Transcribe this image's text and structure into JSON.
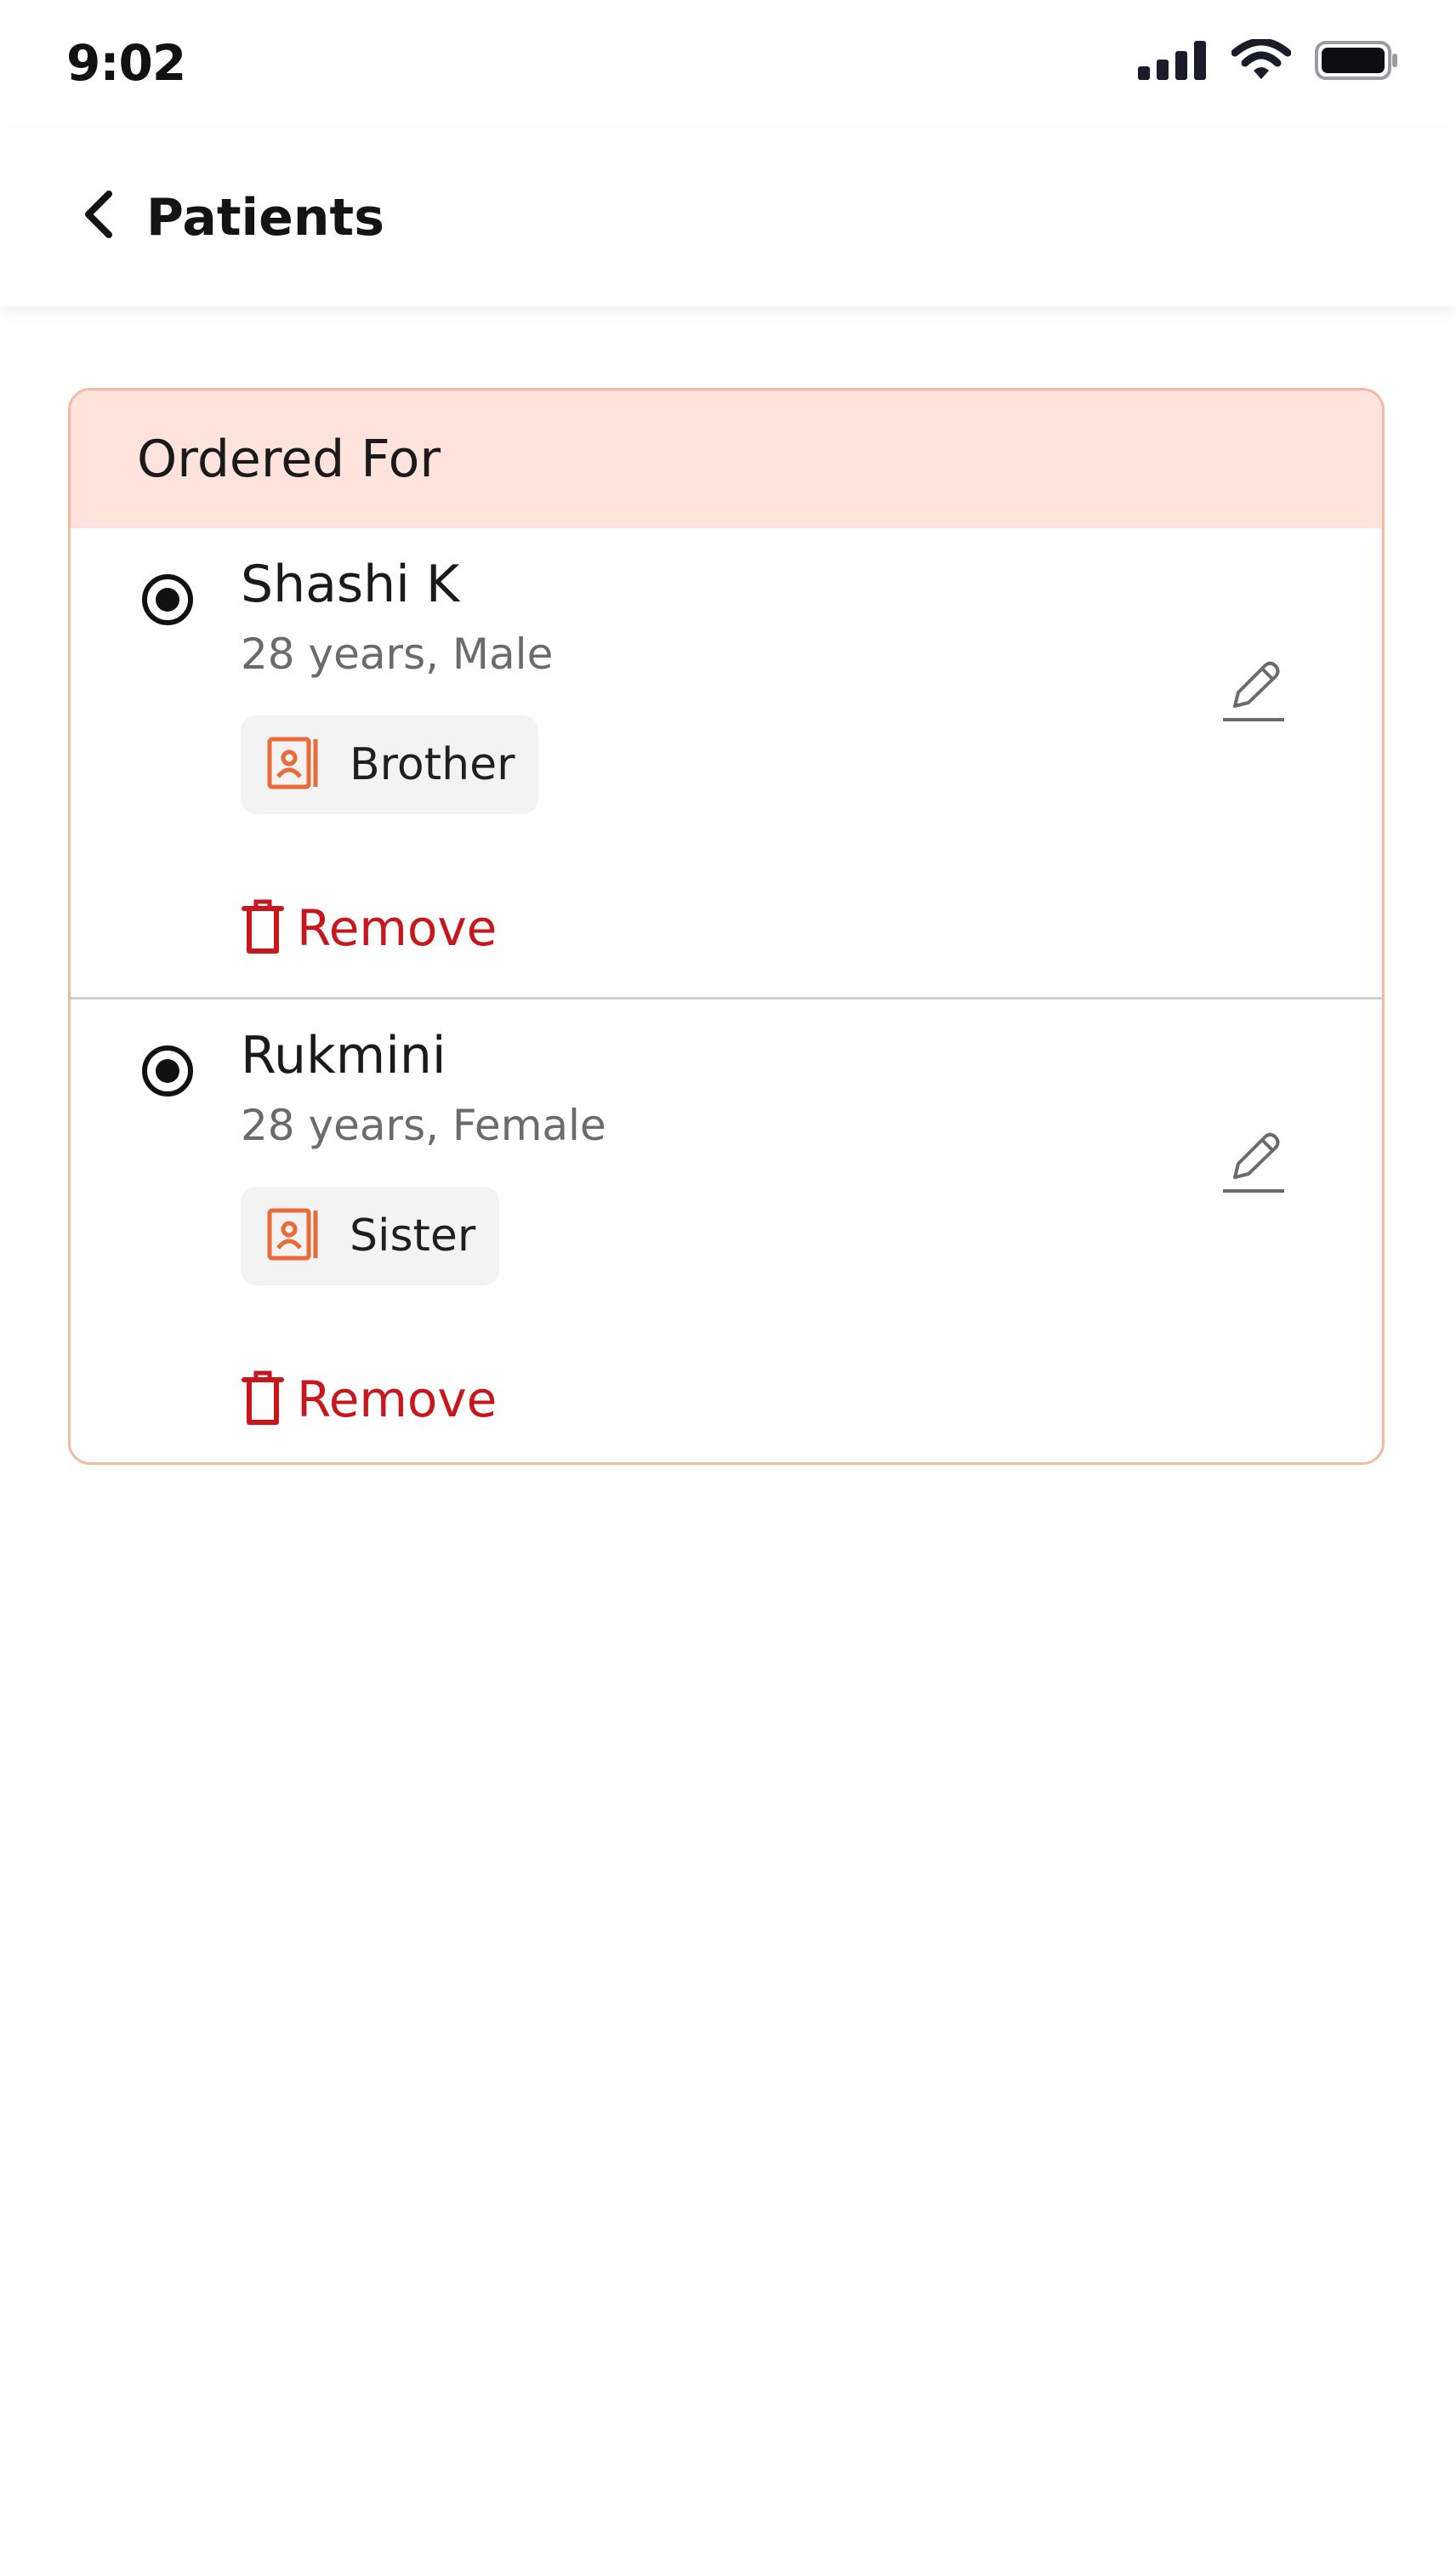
{
  "status_bar": {
    "time": "9:02",
    "icons": [
      "signal-icon",
      "wifi-icon",
      "battery-icon"
    ]
  },
  "header": {
    "title": "Patients",
    "back_icon": "chevron-left-icon"
  },
  "card": {
    "title": "Ordered For",
    "patients": [
      {
        "name": "Shashi K",
        "meta": "28 years, Male",
        "relation": "Brother",
        "selected": true,
        "remove_label": "Remove"
      },
      {
        "name": "Rukmini",
        "meta": "28 years, Female",
        "relation": "Sister",
        "selected": true,
        "remove_label": "Remove"
      }
    ]
  },
  "colors": {
    "accent": "#e96b3a",
    "card_border": "#f4b9a3",
    "card_header_bg": "#fde3db",
    "remove": "#c8161d",
    "text": "#1a1a1a",
    "muted": "#6b6b6b"
  }
}
